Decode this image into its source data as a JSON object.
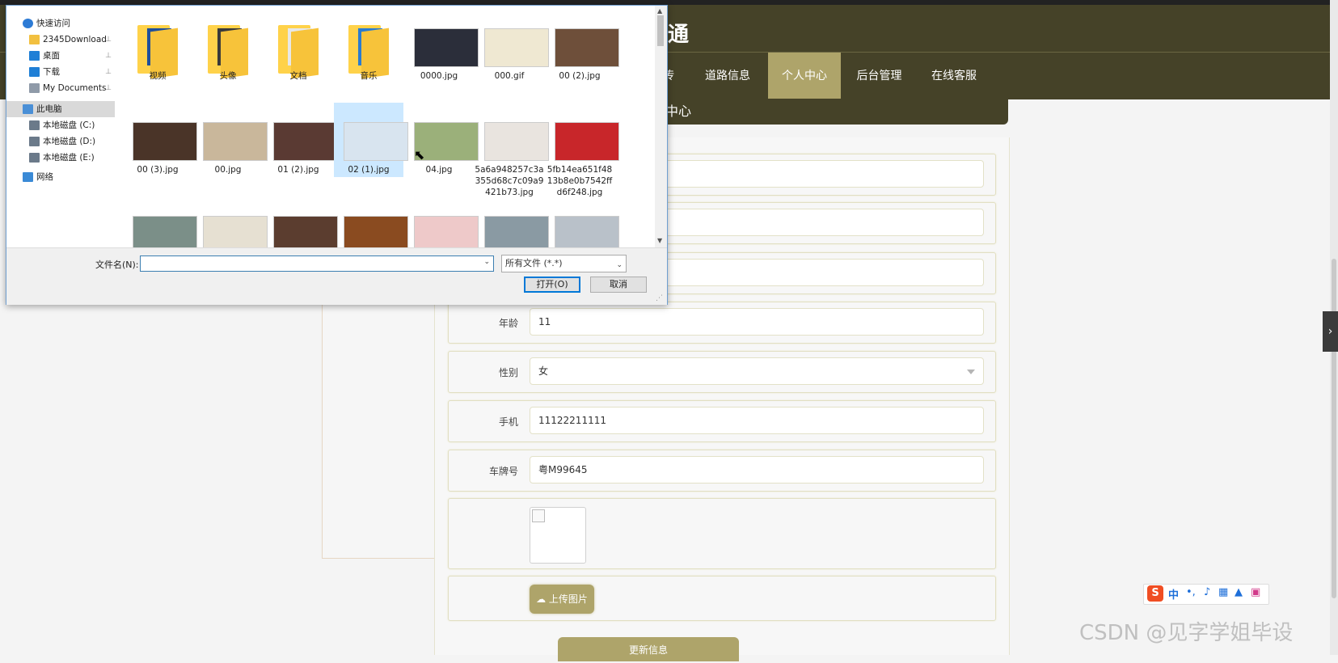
{
  "site": {
    "title": "交通",
    "nav": [
      {
        "label": "宣传",
        "active": false
      },
      {
        "label": "道路信息",
        "active": false
      },
      {
        "label": "个人中心",
        "active": true
      },
      {
        "label": "后台管理",
        "active": false
      },
      {
        "label": "在线客服",
        "active": false
      }
    ],
    "section_title": "中心",
    "form": {
      "age": {
        "label": "年龄",
        "value": "11"
      },
      "gender": {
        "label": "性别",
        "value": "女"
      },
      "phone": {
        "label": "手机",
        "value": "11122211111"
      },
      "plate": {
        "label": "车牌号",
        "value": "粤M99645"
      },
      "upload_label": "上传图片",
      "submit_label": "更新信息"
    }
  },
  "dialog": {
    "nav_pane": [
      {
        "label": "快速访问",
        "icon": "star-icon",
        "pinned": false,
        "selected": false
      },
      {
        "label": "2345Download",
        "icon": "folder-icon",
        "pinned": true,
        "selected": false
      },
      {
        "label": "桌面",
        "icon": "desktop-icon",
        "pinned": true,
        "selected": false
      },
      {
        "label": "下载",
        "icon": "download-icon",
        "pinned": true,
        "selected": false
      },
      {
        "label": "My Documents",
        "icon": "documents-icon",
        "pinned": true,
        "selected": false
      },
      {
        "label": "此电脑",
        "icon": "computer-icon",
        "pinned": false,
        "selected": true
      },
      {
        "label": "本地磁盘 (C:)",
        "icon": "drive-icon",
        "pinned": false,
        "selected": false
      },
      {
        "label": "本地磁盘 (D:)",
        "icon": "drive-icon",
        "pinned": false,
        "selected": false
      },
      {
        "label": "本地磁盘 (E:)",
        "icon": "drive-icon",
        "pinned": false,
        "selected": false
      },
      {
        "label": "网络",
        "icon": "network-icon",
        "pinned": false,
        "selected": false
      }
    ],
    "files": [
      {
        "name": "视频",
        "kind": "folder",
        "overlay": "video"
      },
      {
        "name": "头像",
        "kind": "folder",
        "overlay": "portrait"
      },
      {
        "name": "文档",
        "kind": "folder",
        "overlay": "docs"
      },
      {
        "name": "音乐",
        "kind": "folder",
        "overlay": "music"
      },
      {
        "name": "0000.jpg",
        "kind": "image",
        "color": "#2b2e3a"
      },
      {
        "name": "000.gif",
        "kind": "image",
        "color": "#efe8d2"
      },
      {
        "name": "00 (2).jpg",
        "kind": "image",
        "color": "#6e4f3a"
      },
      {
        "name": "00 (3).jpg",
        "kind": "image",
        "color": "#4a3428"
      },
      {
        "name": "00.jpg",
        "kind": "image",
        "color": "#c9b79b"
      },
      {
        "name": "01 (2).jpg",
        "kind": "image",
        "color": "#5a3a33"
      },
      {
        "name": "02 (1).jpg",
        "kind": "image",
        "color": "#d8e4ef",
        "selected": true
      },
      {
        "name": "04.jpg",
        "kind": "image",
        "color": "#9bb07a"
      },
      {
        "name": "5a6a948257c3a355d68c7c09a9421b73.jpg",
        "kind": "image",
        "color": "#e9e4df"
      },
      {
        "name": "5fb14ea651f4813b8e0b7542ffd6f248.jpg",
        "kind": "image",
        "color": "#c8262a"
      },
      {
        "name": "",
        "kind": "image",
        "color": "#7b8f88"
      },
      {
        "name": "",
        "kind": "image",
        "color": "#e6e0d2"
      },
      {
        "name": "",
        "kind": "image",
        "color": "#5b3d2f"
      },
      {
        "name": "",
        "kind": "image",
        "color": "#8a4b20"
      },
      {
        "name": "",
        "kind": "image",
        "color": "#eec9c9"
      },
      {
        "name": "",
        "kind": "image",
        "color": "#8a9aa3"
      },
      {
        "name": "",
        "kind": "image",
        "color": "#b9c1c9"
      }
    ],
    "filename_label": "文件名(N):",
    "filename_value": "",
    "filetype": "所有文件 (*.*)",
    "open_label": "打开(O)",
    "cancel_label": "取消"
  },
  "ime": {
    "logo": "S",
    "mode": "中",
    "punct": "•,"
  },
  "watermark": "CSDN @见字学姐毕设"
}
